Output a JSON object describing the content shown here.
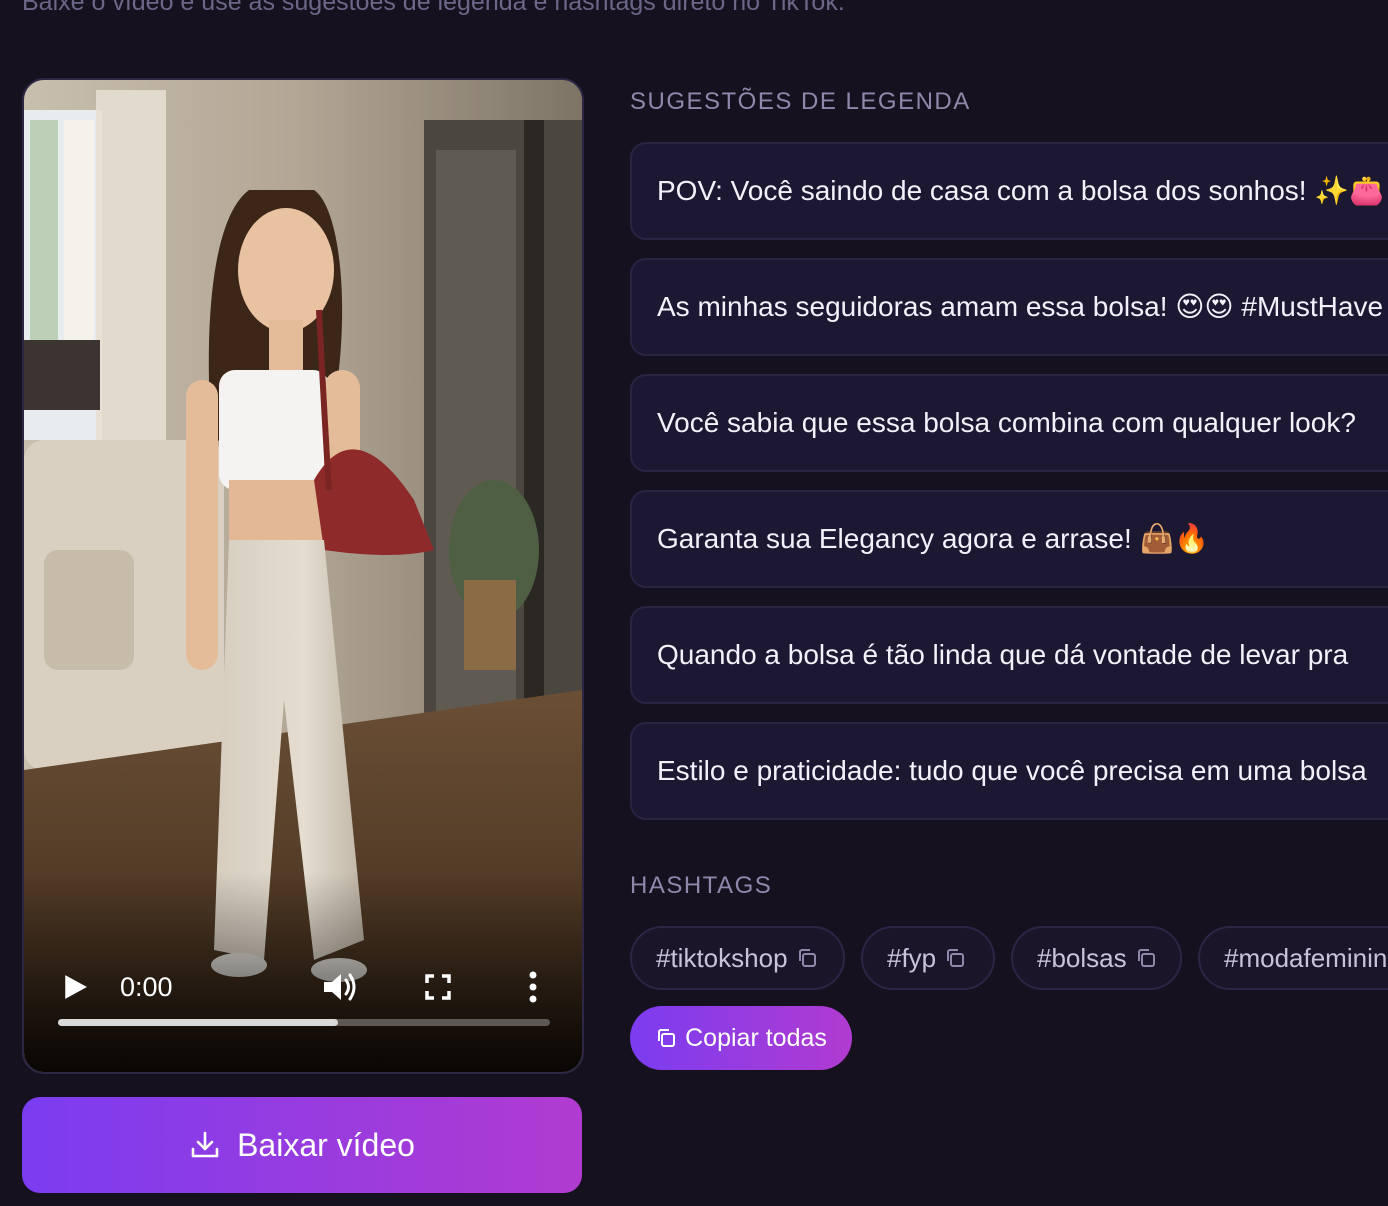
{
  "header": {
    "subtitle": "Baixe o vídeo e use as sugestões de legenda e hashtags direto no TikTok."
  },
  "video": {
    "time": "0:00",
    "progress": 0.57,
    "icons": [
      "play-icon",
      "volume-icon",
      "fullscreen-icon",
      "more-icon"
    ]
  },
  "download": {
    "label": "Baixar vídeo",
    "icon": "download-icon"
  },
  "captions": {
    "title": "SUGESTÕES DE LEGENDA",
    "items": [
      "POV: Você saindo de casa com a bolsa dos sonhos! ✨👛",
      "As minhas seguidoras amam essa bolsa! 😍😍 #MustHave",
      "Você sabia que essa bolsa combina com qualquer look?",
      "Garanta sua Elegancy agora e arrase! 👜🔥",
      "Quando a bolsa é tão linda que dá vontade de levar pra",
      "Estilo e praticidade: tudo que você precisa em uma bolsa"
    ]
  },
  "hashtags": {
    "title": "HASHTAGS",
    "items": [
      "#tiktokshop",
      "#fyp",
      "#bolsas",
      "#modafeminina"
    ],
    "copy_all_label": "Copiar todas",
    "copy_icon": "copy-icon"
  },
  "colors": {
    "background": "#15111f",
    "card": "#1d1832",
    "accent_start": "#7b3cf0",
    "accent_end": "#b13bd0"
  }
}
